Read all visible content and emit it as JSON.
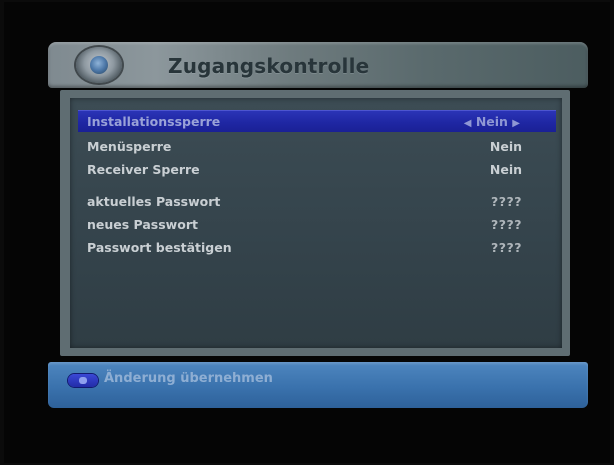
{
  "header": {
    "title": "Zugangskontrolle",
    "icon": "disc-icon"
  },
  "menu": {
    "items": [
      {
        "label": "Installationssperre",
        "value": "Nein",
        "selected": true
      },
      {
        "label": "Menüsperre",
        "value": "Nein",
        "selected": false
      },
      {
        "label": "Receiver Sperre",
        "value": "Nein",
        "selected": false
      }
    ],
    "passwords": [
      {
        "label": "aktuelles Passwort",
        "value": "????"
      },
      {
        "label": "neues Passwort",
        "value": "????"
      },
      {
        "label": "Passwort bestätigen",
        "value": "????"
      }
    ],
    "arrows": {
      "left": "◀",
      "right": "▶"
    }
  },
  "footer": {
    "key_icon": "ok-key-icon",
    "hint": "Änderung übernehmen"
  },
  "colors": {
    "selection": "#1f27a4",
    "panel": "#34434b",
    "footer": "#3a72ad"
  }
}
